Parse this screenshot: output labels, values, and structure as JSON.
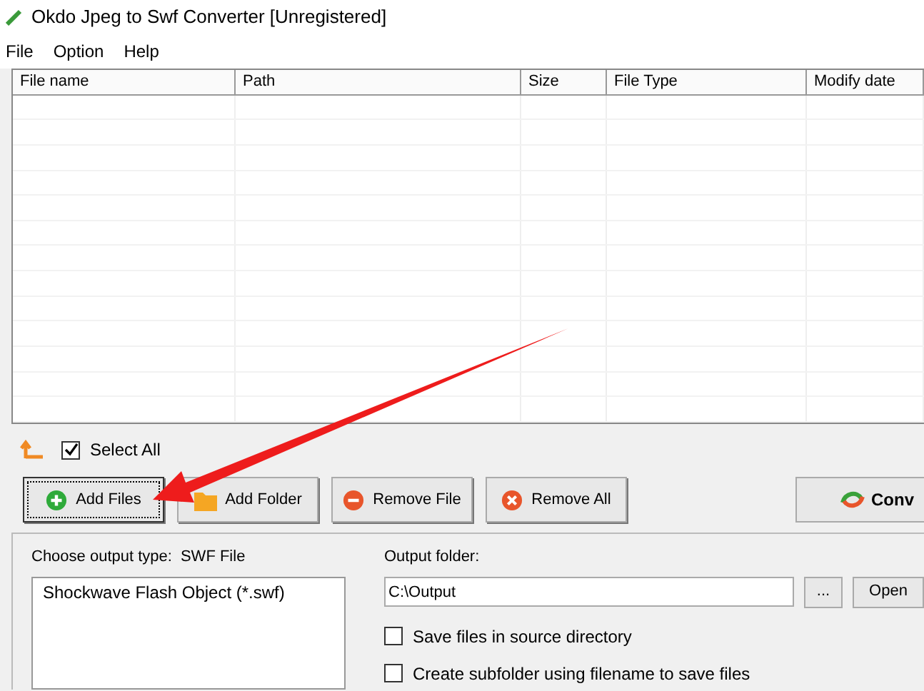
{
  "window": {
    "title": "Okdo Jpeg to Swf Converter [Unregistered]"
  },
  "menu": [
    "File",
    "Option",
    "Help"
  ],
  "table": {
    "columns": [
      "File name",
      "Path",
      "Size",
      "File Type",
      "Modify date"
    ]
  },
  "select_all": {
    "label": "Select All",
    "checked": true
  },
  "buttons": [
    {
      "kind": "add",
      "label": "Add Files"
    },
    {
      "kind": "folder",
      "label": "Add Folder"
    },
    {
      "kind": "remove",
      "label": "Remove File"
    },
    {
      "kind": "clear",
      "label": "Remove All"
    }
  ],
  "convert_button": {
    "label": "Conv"
  },
  "output_type": {
    "label": "Choose output type:",
    "value": "SWF File",
    "items": [
      "Shockwave Flash Object (*.swf)"
    ]
  },
  "output_folder": {
    "label": "Output folder:",
    "value": "C:\\Output",
    "browse": "...",
    "open": "Open"
  },
  "options": [
    {
      "label": "Save files in source directory",
      "checked": false
    },
    {
      "label": "Create subfolder using filename to save files",
      "checked": false
    }
  ]
}
